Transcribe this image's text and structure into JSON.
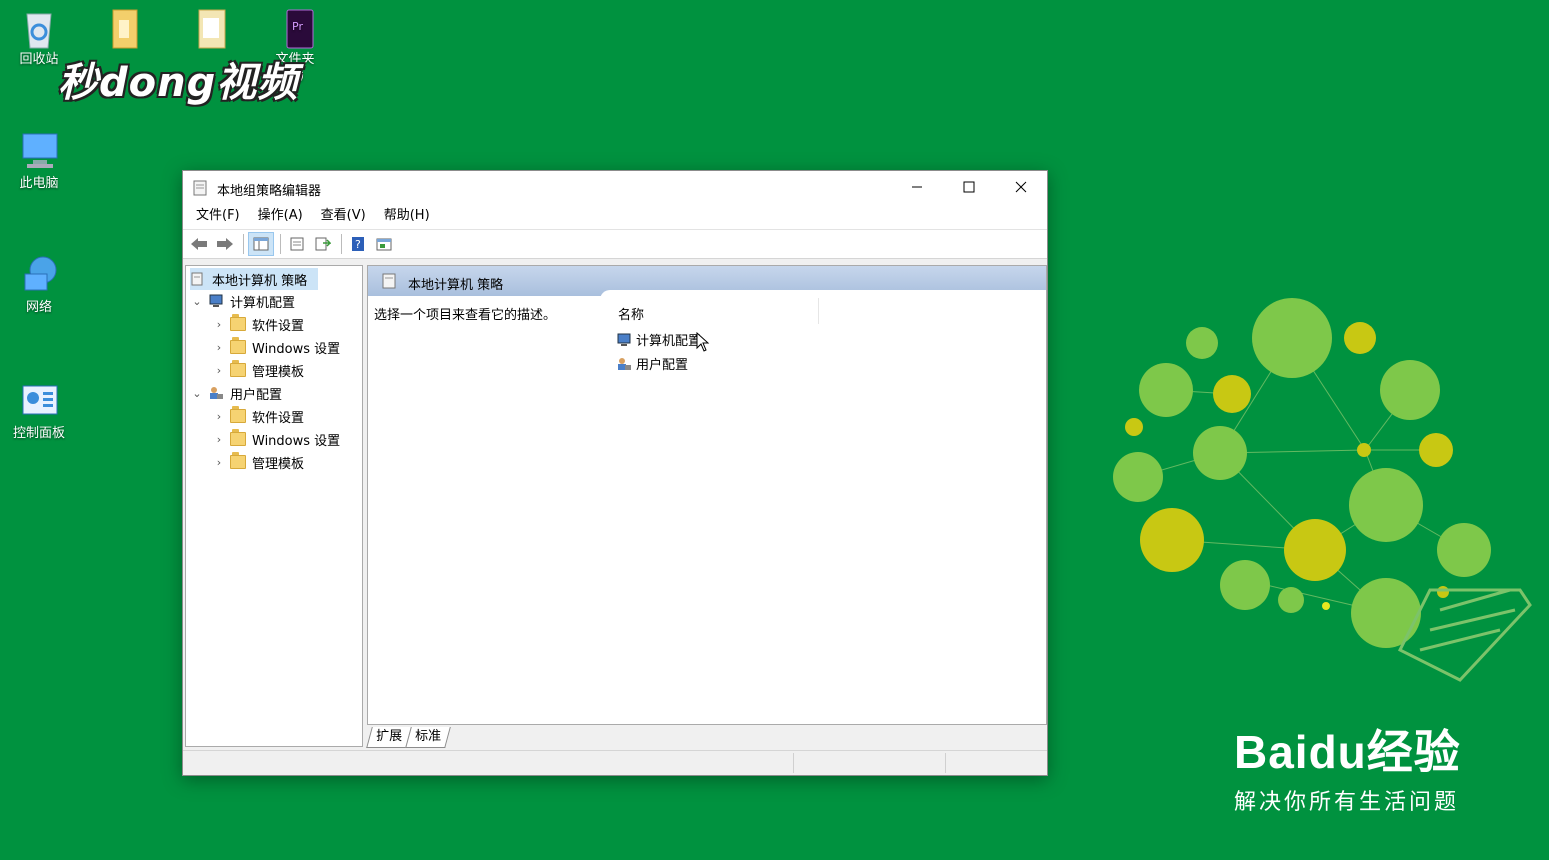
{
  "desktop": {
    "icons": [
      {
        "label": "回收站",
        "icon": "recycle-bin-icon"
      },
      {
        "label": "文件夹\n(2)",
        "icon": "folder-icon"
      },
      {
        "label": "此电脑",
        "icon": "computer-icon"
      },
      {
        "label": "网络",
        "icon": "network-icon"
      },
      {
        "label": "控制面板",
        "icon": "control-panel-icon"
      }
    ],
    "watermark": "秒dong视频"
  },
  "window": {
    "title": "本地组策略编辑器",
    "menu": [
      "文件(F)",
      "操作(A)",
      "查看(V)",
      "帮助(H)"
    ],
    "tree": {
      "root": "本地计算机 策略",
      "computer_config": "计算机配置",
      "user_config": "用户配置",
      "software": "软件设置",
      "windows": "Windows 设置",
      "templates": "管理模板"
    },
    "right_header": "本地计算机 策略",
    "description": "选择一个项目来查看它的描述。",
    "column_name": "名称",
    "items": [
      "计算机配置",
      "用户配置"
    ],
    "tabs": [
      "扩展",
      "标准"
    ]
  },
  "brand": {
    "logo": "Bai​du经验",
    "tagline": "解决你所有生活问题"
  },
  "colors": {
    "desktop": "#00923f",
    "header": "#b6c9e4",
    "selection": "#cce4f7"
  }
}
